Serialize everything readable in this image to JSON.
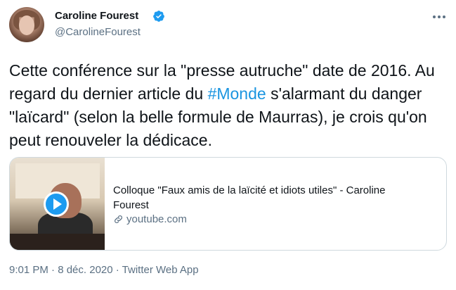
{
  "author": {
    "name": "Caroline Fourest",
    "handle": "@CarolineFourest",
    "verified": true
  },
  "tweet": {
    "text_before_hashtag": "Cette conférence sur la \"presse autruche\" date de 2016. Au regard du dernier article du ",
    "hashtag": "#Monde",
    "text_after_hashtag": " s'alarmant du danger \"laïcard\" (selon la belle formule de Maurras), je crois qu'on peut renouveler la dédicace."
  },
  "card": {
    "title": "Colloque \"Faux amis de la laïcité et idiots utiles\" - Caroline Fourest",
    "domain": "youtube.com"
  },
  "meta": {
    "timestamp": "9:01 PM · 8 déc. 2020 · Twitter Web App"
  },
  "colors": {
    "text": "#0f1419",
    "secondary": "#5b7083",
    "link": "#1b95e0",
    "verified": "#1d9bf0",
    "border": "#cfd9de"
  },
  "icons": {
    "verified": "verified-badge-icon",
    "more": "more-options-icon",
    "play": "play-icon",
    "link": "link-icon"
  }
}
